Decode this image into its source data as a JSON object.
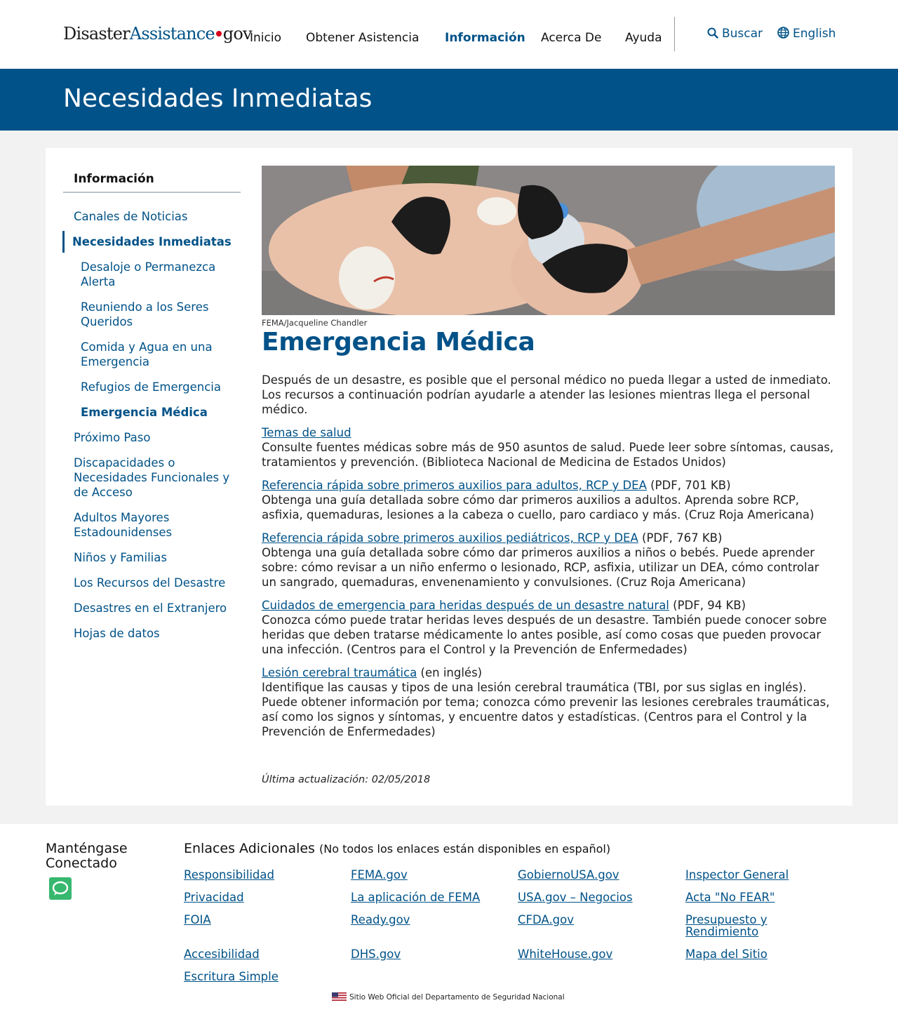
{
  "header": {
    "logo": {
      "part1": "Disaster",
      "part2": "Assistance",
      "part3": "gov"
    },
    "nav": [
      {
        "label": "Inicio"
      },
      {
        "label": "Obtener Asistencia"
      },
      {
        "label": "Información",
        "active": true
      },
      {
        "label": "Acerca De"
      },
      {
        "label": "Ayuda"
      }
    ],
    "search_label": "Buscar",
    "language_label": "English"
  },
  "banner": {
    "title": "Necesidades Inmediatas"
  },
  "sidebar": {
    "title": "Información",
    "items": [
      {
        "label": "Canales de Noticias"
      },
      {
        "label": "Necesidades Inmediatas",
        "current": true
      },
      {
        "label": "Desaloje o Permanezca Alerta"
      },
      {
        "label": "Reuniendo a los Seres Queridos"
      },
      {
        "label": "Comida y Agua en una Emergencia"
      },
      {
        "label": "Refugios de Emergencia"
      },
      {
        "label": "Emergencia Médica",
        "current": true
      },
      {
        "label": "Próximo Paso"
      },
      {
        "label": "Discapacidades o Necesidades Funcionales y de Acceso"
      },
      {
        "label": "Adultos Mayores Estadounidenses"
      },
      {
        "label": "Niños y Familias"
      },
      {
        "label": "Los Recursos del Desastre"
      },
      {
        "label": "Desastres en el Extranjero"
      },
      {
        "label": "Hojas de datos"
      }
    ]
  },
  "main": {
    "image_caption": "FEMA/Jacqueline Chandler",
    "title": "Emergencia Médica",
    "intro": "Después de un desastre, es posible que el personal médico no pueda llegar a usted de inmediato. Los recursos a continuación podrían ayudarle a atender las lesiones mientras llega el personal médico.",
    "resources": [
      {
        "link": "Temas de salud",
        "suffix": "",
        "description": "Consulte fuentes médicas sobre más de 950 asuntos de salud. Puede leer sobre síntomas, causas, tratamientos y prevención. (Biblioteca Nacional de Medicina de Estados Unidos)"
      },
      {
        "link": "Referencia rápida sobre primeros auxilios para adultos, RCP y DEA",
        "suffix": " (PDF, 701 KB)",
        "description": "Obtenga una guía detallada sobre cómo dar primeros auxilios a adultos. Aprenda sobre RCP, asfixia, quemaduras, lesiones a la cabeza o cuello, paro cardiaco y más. (Cruz Roja Americana)"
      },
      {
        "link": "Referencia rápida sobre primeros auxilios pediátricos, RCP y DEA",
        "suffix": " (PDF, 767 KB)",
        "description": "Obtenga una guía detallada sobre cómo dar primeros auxilios a niños o bebés. Puede aprender sobre: cómo revisar a un niño enfermo o lesionado, RCP, asfixia, utilizar un DEA, cómo controlar un sangrado, quemaduras, envenenamiento y convulsiones. (Cruz Roja Americana)"
      },
      {
        "link": "Cuidados de emergencia para heridas después de un desastre natural",
        "suffix": " (PDF, 94 KB)",
        "description": "Conozca cómo puede tratar heridas leves después de un desastre. También puede conocer sobre heridas que deben tratarse médicamente lo antes posible, así como cosas que pueden provocar una infección. (Centros para el Control y la Prevención de Enfermedades)"
      },
      {
        "link": "Lesión cerebral traumática",
        "suffix": " (en inglés)",
        "description": "Identifique las causas y tipos de una lesión cerebral traumática (TBI, por sus siglas en inglés). Puede obtener información por tema; conozca cómo prevenir las lesiones cerebrales traumáticas, así como los signos y síntomas, y encuentre datos y estadísticas. (Centros para el Control y la Prevención de Enfermedades)"
      }
    ],
    "updated": "Última actualización: 02/05/2018"
  },
  "footer": {
    "stay_connected": "Manténgase Conectado",
    "additional_title": "Enlaces Adicionales",
    "additional_note": "(No todos los enlaces están disponibles en español)",
    "links": [
      {
        "label": "Responsibilidad"
      },
      {
        "label": "FEMA.gov"
      },
      {
        "label": "GobiernoUSA.gov"
      },
      {
        "label": "Inspector General"
      },
      {
        "label": "Privacidad"
      },
      {
        "label": "La aplicación de FEMA"
      },
      {
        "label": "USA.gov – Negocios"
      },
      {
        "label": "Acta \"No FEAR\""
      },
      {
        "label": "FOIA"
      },
      {
        "label": "Ready.gov"
      },
      {
        "label": "CFDA.gov"
      },
      {
        "label": "Presupuesto y Rendimiento"
      },
      {
        "label": "Accesibilidad"
      },
      {
        "label": "DHS.gov"
      },
      {
        "label": "WhiteHouse.gov"
      },
      {
        "label": "Mapa del Sitio"
      },
      {
        "label": "Escritura Simple"
      }
    ],
    "official": "Sitio Web Oficial del Departamento de Seguridad Nacional"
  },
  "colors": {
    "brand_blue": "#005288",
    "footer_gray": "#f2f2f2",
    "chat_green": "#37b86f",
    "logo_dot": "#d6001c"
  },
  "icons": [
    "search-icon",
    "globe-icon",
    "chat-icon",
    "us-flag-icon"
  ]
}
